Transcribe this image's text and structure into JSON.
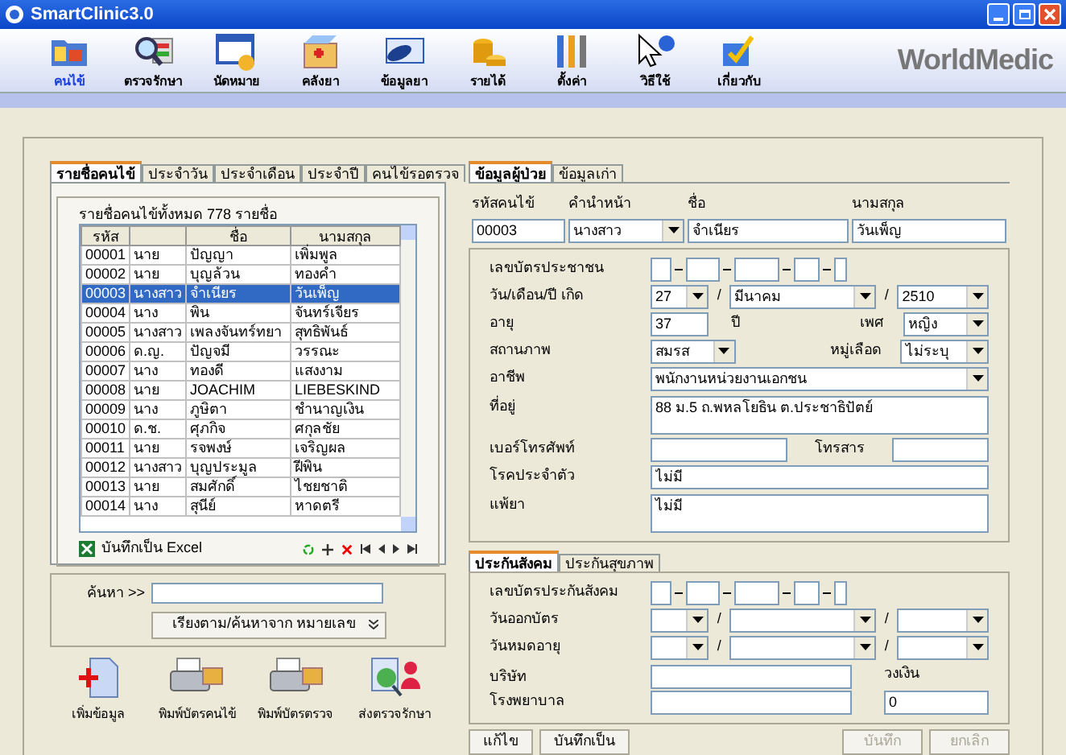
{
  "window": {
    "title": "SmartClinic3.0"
  },
  "toolbar": {
    "items": [
      {
        "label": "คนไข้",
        "selected": true
      },
      {
        "label": "ตรวจรักษา",
        "selected": false
      },
      {
        "label": "นัดหมาย",
        "selected": false
      },
      {
        "label": "คลังยา",
        "selected": false
      },
      {
        "label": "ข้อมูลยา",
        "selected": false
      },
      {
        "label": "รายได้",
        "selected": false
      },
      {
        "label": "ตั้งค่า",
        "selected": false
      },
      {
        "label": "วิธีใช้",
        "selected": false
      },
      {
        "label": "เกี่ยวกับ",
        "selected": false
      }
    ],
    "logo": "WorldMedic"
  },
  "left": {
    "tabs": [
      {
        "label": "รายชื่อคนไข้",
        "selected": true
      },
      {
        "label": "ประจำวัน",
        "selected": false
      },
      {
        "label": "ประจำเดือน",
        "selected": false
      },
      {
        "label": "ประจำปี",
        "selected": false
      },
      {
        "label": "คนไข้รอตรวจ",
        "selected": false
      }
    ],
    "caption": "รายชื่อคนไข้ทั้งหมด 778 รายชื่อ",
    "table": {
      "columns": [
        "รหัส",
        "",
        "ชื่อ",
        "นามสกุล"
      ],
      "rows": [
        {
          "cells": [
            "00001",
            "นาย",
            "ปัญญา",
            "เพิ่มพูล"
          ],
          "selected": false
        },
        {
          "cells": [
            "00002",
            "นาย",
            "บุญล้วน",
            "ทองคำ"
          ],
          "selected": false
        },
        {
          "cells": [
            "00003",
            "นางสาว",
            "จำเนียร",
            "วันเพ็ญ"
          ],
          "selected": true
        },
        {
          "cells": [
            "00004",
            "นาง",
            "พิน",
            "จันทร์เจียร"
          ],
          "selected": false
        },
        {
          "cells": [
            "00005",
            "นางสาว",
            "เพลงจันทร์ทยา",
            "สุทธิพันธ์"
          ],
          "selected": false
        },
        {
          "cells": [
            "00006",
            "ด.ญ.",
            "ปัญจมี",
            "วรรณะ"
          ],
          "selected": false
        },
        {
          "cells": [
            "00007",
            "นาง",
            "ทองดี",
            "แสงงาม"
          ],
          "selected": false
        },
        {
          "cells": [
            "00008",
            "นาย",
            "JOACHIM",
            "LIEBESKIND"
          ],
          "selected": false
        },
        {
          "cells": [
            "00009",
            "นาง",
            "ภูษิตา",
            "ชำนาญเงิน"
          ],
          "selected": false
        },
        {
          "cells": [
            "00010",
            "ด.ช.",
            "ศุภกิจ",
            "ศกุลชัย"
          ],
          "selected": false
        },
        {
          "cells": [
            "00011",
            "นาย",
            "รจพงษ์",
            "เจริญผล"
          ],
          "selected": false
        },
        {
          "cells": [
            "00012",
            "นางสาว",
            "บุญประมูล",
            "ฝีพิน"
          ],
          "selected": false
        },
        {
          "cells": [
            "00013",
            "นาย",
            "สมศักดิ์",
            "ไชยชาติ"
          ],
          "selected": false
        },
        {
          "cells": [
            "00014",
            "นาง",
            "สุนีย์",
            "หาดตรี"
          ],
          "selected": false
        }
      ]
    },
    "export_label": "บันทึกเป็น Excel",
    "search": {
      "label": "ค้นหา >>",
      "sort_button": "เรียงตาม/ค้นหาจาก หมายเลข"
    },
    "actions": [
      "เพิ่มข้อมูล",
      "พิมพ์บัตรคนไข้",
      "พิมพ์บัตรตรวจ",
      "ส่งตรวจรักษา"
    ]
  },
  "right": {
    "tabs": [
      {
        "label": "ข้อมูลผู้ป่วย",
        "selected": true
      },
      {
        "label": "ข้อมูลเก่า",
        "selected": false
      }
    ],
    "header_fields": [
      {
        "label": "รหัสคนไข้",
        "value": "00003",
        "kind": "text"
      },
      {
        "label": "คำนำหน้า",
        "value": "นางสาว",
        "kind": "select"
      },
      {
        "label": "ชื่อ",
        "value": "จำเนียร",
        "kind": "text"
      },
      {
        "label": "นามสกุล",
        "value": "วันเพ็ญ",
        "kind": "text"
      }
    ],
    "personal": [
      {
        "kind": "id",
        "label": "เลขบัตรประชาชน"
      },
      {
        "kind": "date",
        "label": "วัน/เดือน/ปี เกิด",
        "day": "27",
        "sep1": "/",
        "month": "มีนาคม",
        "sep2": "/",
        "year": "2510"
      },
      {
        "kind": "pair",
        "label": "อายุ",
        "value": "37",
        "unit": "ปี",
        "label2": "เพศ",
        "value2": "หญิง"
      },
      {
        "kind": "pair",
        "label": "สถานภาพ",
        "value": "สมรส",
        "label2": "หมู่เลือด",
        "value2": "ไม่ระบุ"
      },
      {
        "kind": "select",
        "label": "อาชีพ",
        "value": "พนักงานหน่วยงานเอกชน"
      },
      {
        "kind": "area",
        "label": "ที่อยู่",
        "value": "88 ม.5 ถ.พหลโยธิน ต.ประชาธิปัตย์"
      },
      {
        "kind": "phone",
        "label": "เบอร์โทรศัพท์",
        "label2": "โทรสาร"
      },
      {
        "kind": "text",
        "label": "โรคประจำตัว",
        "value": "ไม่มี"
      },
      {
        "kind": "area",
        "label": "แพ้ยา",
        "value": "ไม่มี"
      }
    ],
    "insurance_tabs": [
      {
        "label": "ประกันสังคม",
        "selected": true
      },
      {
        "label": "ประกันสุขภาพ",
        "selected": false
      }
    ],
    "insurance": [
      {
        "kind": "id",
        "label": "เลขบัตรประกันสังคม"
      },
      {
        "kind": "date",
        "label": "วันออกบัตร",
        "sep1": "/",
        "sep2": "/"
      },
      {
        "kind": "date",
        "label": "วันหมดอายุ",
        "sep1": "/",
        "sep2": "/"
      },
      {
        "kind": "company",
        "label": "บริษัท",
        "label2": "วงเงิน"
      },
      {
        "kind": "hospital",
        "label": "โรงพยาบาล",
        "value2": "0"
      }
    ],
    "buttons": [
      {
        "label": "แก้ไข",
        "disabled": false
      },
      {
        "label": "บันทึกเป็น",
        "disabled": false
      },
      {
        "label": "บันทึก",
        "disabled": true
      },
      {
        "label": "ยกเลิก",
        "disabled": true
      }
    ]
  }
}
